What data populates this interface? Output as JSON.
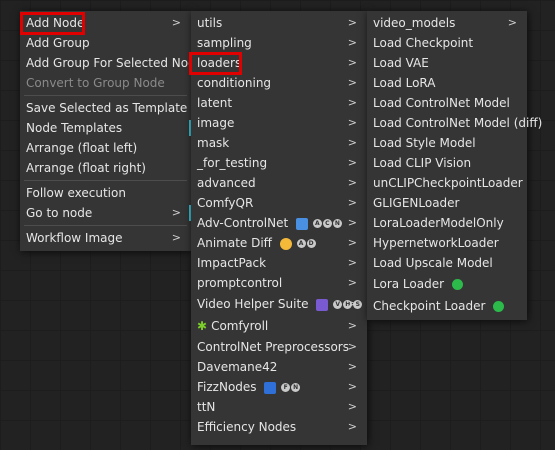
{
  "menu1": {
    "items": [
      {
        "label": "Add Node",
        "arrow": ">",
        "highlight": true
      },
      {
        "label": "Add Group"
      },
      {
        "label": "Add Group For Selected Nodes"
      },
      {
        "label": "Convert to Group Node",
        "disabled": true
      },
      {
        "label": "Save Selected as Template"
      },
      {
        "label": "Node Templates",
        "bar": true
      },
      {
        "label": "Arrange (float left)"
      },
      {
        "label": "Arrange (float right)"
      },
      {
        "label": "Follow execution"
      },
      {
        "label": "Go to node",
        "arrow": ">",
        "bar": true
      },
      {
        "label": "Workflow Image",
        "arrow": ">"
      }
    ]
  },
  "menu2": {
    "items": [
      {
        "label": "utils",
        "arrow": ">"
      },
      {
        "label": "sampling",
        "arrow": ">"
      },
      {
        "label": "loaders",
        "arrow": ">",
        "highlight": true
      },
      {
        "label": "conditioning",
        "arrow": ">"
      },
      {
        "label": "latent",
        "arrow": ">"
      },
      {
        "label": "image",
        "arrow": ">"
      },
      {
        "label": "mask",
        "arrow": ">"
      },
      {
        "label": "_for_testing",
        "arrow": ">"
      },
      {
        "label": "advanced",
        "arrow": ">"
      },
      {
        "label": "ComfyQR",
        "arrow": ">"
      },
      {
        "label": "Adv-ControlNet",
        "arrow": ">"
      },
      {
        "label": "Animate Diff",
        "arrow": ">"
      },
      {
        "label": "ImpactPack",
        "arrow": ">"
      },
      {
        "label": "promptcontrol",
        "arrow": ">"
      },
      {
        "label": "Video Helper Suite",
        "arrow": ">"
      },
      {
        "label": "Comfyroll",
        "arrow": ">"
      },
      {
        "label": "ControlNet Preprocessors",
        "arrow": ">"
      },
      {
        "label": "Davemane42",
        "arrow": ">"
      },
      {
        "label": "FizzNodes",
        "arrow": ">"
      },
      {
        "label": "ttN",
        "arrow": ">"
      },
      {
        "label": "Efficiency Nodes",
        "arrow": ">"
      }
    ]
  },
  "menu3": {
    "items": [
      {
        "label": "video_models",
        "arrow": ">"
      },
      {
        "label": "Load Checkpoint"
      },
      {
        "label": "Load VAE"
      },
      {
        "label": "Load LoRA"
      },
      {
        "label": "Load ControlNet Model"
      },
      {
        "label": "Load ControlNet Model (diff)"
      },
      {
        "label": "Load Style Model"
      },
      {
        "label": "Load CLIP Vision"
      },
      {
        "label": "unCLIPCheckpointLoader"
      },
      {
        "label": "GLIGENLoader"
      },
      {
        "label": "LoraLoaderModelOnly"
      },
      {
        "label": "HypernetworkLoader"
      },
      {
        "label": "Load Upscale Model"
      },
      {
        "label": "Lora Loader"
      },
      {
        "label": "Checkpoint Loader"
      }
    ]
  },
  "badges": {
    "acn": [
      "A",
      "C",
      "N"
    ],
    "ad": [
      "A",
      "D"
    ],
    "vhs": [
      "V",
      "H",
      "S"
    ],
    "fn": [
      "F",
      "N"
    ]
  },
  "icons": {
    "adv_controlnet": "controlnet-logo-icon",
    "animate_diff": "theater-masks-icon",
    "video_helper": "alien-icon",
    "comfyroll": "puzzle-leaf-icon",
    "fizznodes": "calendar-icon",
    "lora_loader": "green-loop-icon",
    "checkpoint_loader": "green-loop-icon"
  },
  "colors": {
    "highlight": "#e00000",
    "accent_bar": "#39c5d9",
    "menu_bg": "#353535",
    "canvas_bg": "#222222"
  }
}
